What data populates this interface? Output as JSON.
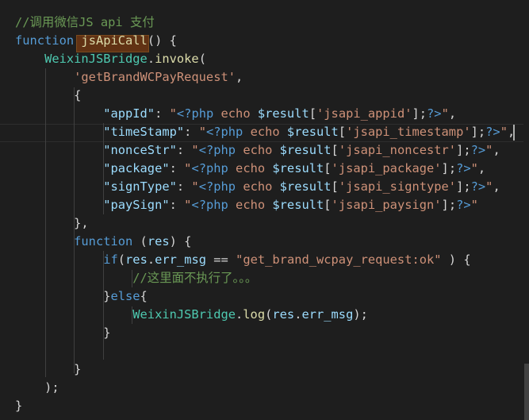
{
  "editor": {
    "colors": {
      "background": "#1e1e1e",
      "keyword": "#569cd6",
      "function": "#dcdcaa",
      "string": "#ce9178",
      "comment": "#6a9955",
      "variable": "#9cdcfe",
      "class": "#4ec9b0",
      "punctuation": "#d4d4d4",
      "word_highlight": "#613214"
    },
    "current_line": 7,
    "highlighted_word": "jsApiCall",
    "lines": [
      {
        "tokens": [
          {
            "t": "//调用微信JS api 支付",
            "c": "cmt"
          }
        ]
      },
      {
        "tokens": [
          {
            "t": "function",
            "c": "kw"
          },
          {
            "t": " ",
            "c": "pun"
          },
          {
            "t": "jsApiCall",
            "c": "fn"
          },
          {
            "t": "() {",
            "c": "pun"
          }
        ]
      },
      {
        "tokens": [
          {
            "t": "    ",
            "c": "pun"
          },
          {
            "t": "WeixinJSBridge",
            "c": "cls"
          },
          {
            "t": ".",
            "c": "pun"
          },
          {
            "t": "invoke",
            "c": "fn"
          },
          {
            "t": "(",
            "c": "pun"
          }
        ]
      },
      {
        "tokens": [
          {
            "t": "        ",
            "c": "pun"
          },
          {
            "t": "'getBrandWCPayRequest'",
            "c": "str"
          },
          {
            "t": ",",
            "c": "pun"
          }
        ]
      },
      {
        "tokens": [
          {
            "t": "        {",
            "c": "pun"
          }
        ]
      },
      {
        "tokens": [
          {
            "t": "            ",
            "c": "pun"
          },
          {
            "t": "\"appId\"",
            "c": "var"
          },
          {
            "t": ": ",
            "c": "pun"
          },
          {
            "t": "\"",
            "c": "str"
          },
          {
            "t": "<?php",
            "c": "php"
          },
          {
            "t": " echo ",
            "c": "str"
          },
          {
            "t": "$result",
            "c": "var"
          },
          {
            "t": "[",
            "c": "pun"
          },
          {
            "t": "'jsapi_appid'",
            "c": "str"
          },
          {
            "t": "];",
            "c": "pun"
          },
          {
            "t": "?>",
            "c": "php"
          },
          {
            "t": "\"",
            "c": "str"
          },
          {
            "t": ",",
            "c": "pun"
          }
        ]
      },
      {
        "tokens": [
          {
            "t": "            ",
            "c": "pun"
          },
          {
            "t": "\"timeStamp\"",
            "c": "var"
          },
          {
            "t": ": ",
            "c": "pun"
          },
          {
            "t": "\"",
            "c": "str"
          },
          {
            "t": "<?php",
            "c": "php"
          },
          {
            "t": " echo ",
            "c": "str"
          },
          {
            "t": "$result",
            "c": "var"
          },
          {
            "t": "[",
            "c": "pun"
          },
          {
            "t": "'jsapi_timestamp'",
            "c": "str"
          },
          {
            "t": "];",
            "c": "pun"
          },
          {
            "t": "?>",
            "c": "php"
          },
          {
            "t": "\"",
            "c": "str"
          },
          {
            "t": ",",
            "c": "pun"
          }
        ]
      },
      {
        "tokens": [
          {
            "t": "            ",
            "c": "pun"
          },
          {
            "t": "\"nonceStr\"",
            "c": "var"
          },
          {
            "t": ": ",
            "c": "pun"
          },
          {
            "t": "\"",
            "c": "str"
          },
          {
            "t": "<?php",
            "c": "php"
          },
          {
            "t": " echo ",
            "c": "str"
          },
          {
            "t": "$result",
            "c": "var"
          },
          {
            "t": "[",
            "c": "pun"
          },
          {
            "t": "'jsapi_noncestr'",
            "c": "str"
          },
          {
            "t": "];",
            "c": "pun"
          },
          {
            "t": "?>",
            "c": "php"
          },
          {
            "t": "\"",
            "c": "str"
          },
          {
            "t": ",",
            "c": "pun"
          }
        ]
      },
      {
        "tokens": [
          {
            "t": "            ",
            "c": "pun"
          },
          {
            "t": "\"package\"",
            "c": "var"
          },
          {
            "t": ": ",
            "c": "pun"
          },
          {
            "t": "\"",
            "c": "str"
          },
          {
            "t": "<?php",
            "c": "php"
          },
          {
            "t": " echo ",
            "c": "str"
          },
          {
            "t": "$result",
            "c": "var"
          },
          {
            "t": "[",
            "c": "pun"
          },
          {
            "t": "'jsapi_package'",
            "c": "str"
          },
          {
            "t": "];",
            "c": "pun"
          },
          {
            "t": "?>",
            "c": "php"
          },
          {
            "t": "\"",
            "c": "str"
          },
          {
            "t": ",",
            "c": "pun"
          }
        ]
      },
      {
        "tokens": [
          {
            "t": "            ",
            "c": "pun"
          },
          {
            "t": "\"signType\"",
            "c": "var"
          },
          {
            "t": ": ",
            "c": "pun"
          },
          {
            "t": "\"",
            "c": "str"
          },
          {
            "t": "<?php",
            "c": "php"
          },
          {
            "t": " echo ",
            "c": "str"
          },
          {
            "t": "$result",
            "c": "var"
          },
          {
            "t": "[",
            "c": "pun"
          },
          {
            "t": "'jsapi_signtype'",
            "c": "str"
          },
          {
            "t": "];",
            "c": "pun"
          },
          {
            "t": "?>",
            "c": "php"
          },
          {
            "t": "\"",
            "c": "str"
          },
          {
            "t": ",",
            "c": "pun"
          }
        ]
      },
      {
        "tokens": [
          {
            "t": "            ",
            "c": "pun"
          },
          {
            "t": "\"paySign\"",
            "c": "var"
          },
          {
            "t": ": ",
            "c": "pun"
          },
          {
            "t": "\"",
            "c": "str"
          },
          {
            "t": "<?php",
            "c": "php"
          },
          {
            "t": " echo ",
            "c": "str"
          },
          {
            "t": "$result",
            "c": "var"
          },
          {
            "t": "[",
            "c": "pun"
          },
          {
            "t": "'jsapi_paysign'",
            "c": "str"
          },
          {
            "t": "];",
            "c": "pun"
          },
          {
            "t": "?>",
            "c": "php"
          },
          {
            "t": "\"",
            "c": "str"
          }
        ]
      },
      {
        "tokens": [
          {
            "t": "        },",
            "c": "pun"
          }
        ]
      },
      {
        "tokens": [
          {
            "t": "        ",
            "c": "pun"
          },
          {
            "t": "function",
            "c": "kw"
          },
          {
            "t": " (",
            "c": "pun"
          },
          {
            "t": "res",
            "c": "var"
          },
          {
            "t": ") {",
            "c": "pun"
          }
        ]
      },
      {
        "tokens": [
          {
            "t": "            ",
            "c": "pun"
          },
          {
            "t": "if",
            "c": "kw"
          },
          {
            "t": "(",
            "c": "pun"
          },
          {
            "t": "res",
            "c": "var"
          },
          {
            "t": ".",
            "c": "pun"
          },
          {
            "t": "err_msg",
            "c": "var"
          },
          {
            "t": " == ",
            "c": "pun"
          },
          {
            "t": "\"get_brand_wcpay_request:ok\"",
            "c": "str"
          },
          {
            "t": " ) {",
            "c": "pun"
          }
        ]
      },
      {
        "tokens": [
          {
            "t": "                ",
            "c": "pun"
          },
          {
            "t": "//这里面不执行了。。。",
            "c": "cmt"
          }
        ]
      },
      {
        "tokens": [
          {
            "t": "            }",
            "c": "pun"
          },
          {
            "t": "else",
            "c": "kw"
          },
          {
            "t": "{",
            "c": "pun"
          }
        ]
      },
      {
        "tokens": [
          {
            "t": "                ",
            "c": "pun"
          },
          {
            "t": "WeixinJSBridge",
            "c": "cls"
          },
          {
            "t": ".",
            "c": "pun"
          },
          {
            "t": "log",
            "c": "fn"
          },
          {
            "t": "(",
            "c": "pun"
          },
          {
            "t": "res",
            "c": "var"
          },
          {
            "t": ".",
            "c": "pun"
          },
          {
            "t": "err_msg",
            "c": "var"
          },
          {
            "t": ");",
            "c": "pun"
          }
        ]
      },
      {
        "tokens": [
          {
            "t": "            }",
            "c": "pun"
          }
        ]
      },
      {
        "tokens": [
          {
            "t": "",
            "c": "pun"
          }
        ]
      },
      {
        "tokens": [
          {
            "t": "        }",
            "c": "pun"
          }
        ]
      },
      {
        "tokens": [
          {
            "t": "    );",
            "c": "pun"
          }
        ]
      },
      {
        "tokens": [
          {
            "t": "}",
            "c": "pun"
          }
        ]
      }
    ]
  }
}
